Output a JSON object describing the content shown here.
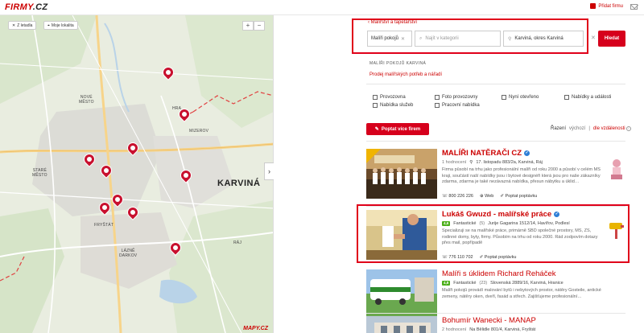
{
  "topbar": {
    "logo": "FIRMY",
    "logo_suffix": ".CZ",
    "add_firm": "Přidat firmu"
  },
  "map": {
    "back_label": "Z letadla",
    "my_location": "Moje lokalita",
    "zoom_in": "+",
    "zoom_out": "−",
    "collapse": "›",
    "watermark": "MAPY.CZ",
    "labels": {
      "nove_mesto": "NOVÉ\nMĚSTO",
      "stare_mesto": "STARÉ\nMĚSTO",
      "mizerov": "MIZEROV",
      "karvina": "KARVINÁ",
      "frystat": "FRYŠTÁT",
      "lazne": "LÁZNĚ\nDARKOV",
      "raj": "RÁJ",
      "hranice": "HRA"
    }
  },
  "search": {
    "back_link": "Malířství a tapetářství",
    "tag": "Malíři pokojů",
    "category_placeholder": "Najít v kategorii",
    "location": "Karviná, okres Karviná",
    "button": "Hledat"
  },
  "category": {
    "heading": "MALÍŘI POKOJŮ KARVINÁ",
    "link": "Prodej malířských potřeb a nářadí"
  },
  "filters": [
    "Provozovna",
    "Foto provozovny",
    "Nyní otevřeno",
    "Nabídky a události",
    "Nabídka služeb",
    "Pracovní nabídka"
  ],
  "actions": {
    "ask_button": "Poptat více firem"
  },
  "sort": {
    "label": "Řazení",
    "default": "výchozí",
    "by_distance": "dle vzdálenosti",
    "separator": "|"
  },
  "listings": [
    {
      "title": "MALÍŘI NATĚRAČI CZ",
      "reviews": "1 hodnocení",
      "address": "17. listopadu 883/2a, Karviná, Ráj",
      "description": "Firma působí na trhu jako profesionální malíři od roku 2000 a působí v celém MS kraji, součástí naší nabídky jsou i bytové designéři která jsou pro naše zákazníky zdarma, zdarma je také nezávazná nabídka, přesun nábytku a úklid…",
      "phone": "800 226 226",
      "web": "Web",
      "ask": "Poptat poptávku"
    },
    {
      "title": "Lukáš Gwuzd - malířské práce",
      "badge": "4,6",
      "rating_text": "Fantastické",
      "rating_count": "(5)",
      "address": "Jurije Gagarina 1512/14, Havířov, Podlesí",
      "description": "Specializuji se na malířské práce, primárně SBD společné prostory, MŠ, ZŠ, rodinné domy, byty, firmy. Působím na trhu od roku 2000. Rád zodpovím dotazy přes mail, popřípadě",
      "phone": "776 110 702",
      "ask": "Poptat poptávku"
    },
    {
      "title": "Malíři s úklidem Richard Reháček",
      "badge": "4,8",
      "rating_text": "Fantastické",
      "rating_count": "(23)",
      "address": "Slovenská 2889/16, Karviná, Hranice",
      "description": "Malíři pokojů provádí malování bytů i nebytových prostor, nátěry Gosteile, antické zemeny, nátěry oken, dveří, fasád a střech. Zajišťujeme profesionální…"
    },
    {
      "title": "Bohumír Wanecki - MANAP",
      "reviews": "2 hodnocení",
      "address": "Na Bělidle 801/4, Karviná, Fryštát"
    }
  ],
  "colors": {
    "brand": "#d6001c",
    "highlight": "#e0001a",
    "badge": "#4caf1a",
    "verified": "#2d7ed6"
  }
}
